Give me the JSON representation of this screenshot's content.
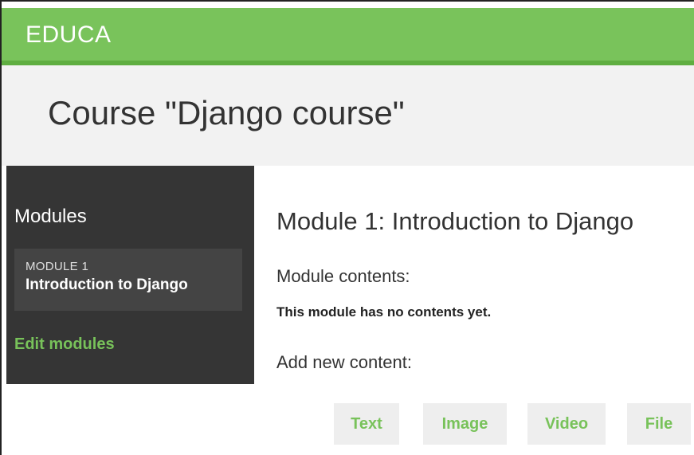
{
  "header": {
    "brand": "EDUCA"
  },
  "course": {
    "title": "Course \"Django course\""
  },
  "sidebar": {
    "title": "Modules",
    "modules": [
      {
        "number": "MODULE 1",
        "name": "Introduction to Django"
      }
    ],
    "edit_link": "Edit modules"
  },
  "main": {
    "module_heading": "Module 1: Introduction to Django",
    "contents_label": "Module contents:",
    "empty_message": "This module has no contents yet.",
    "add_label": "Add new content:",
    "content_buttons": [
      "Text",
      "Image",
      "Video",
      "File"
    ]
  },
  "colors": {
    "brand_green": "#79c35b",
    "brand_green_dark": "#5fae41",
    "sidebar_bg": "#353535",
    "link_green": "#78c25a",
    "title_band_bg": "#f2f2f2"
  }
}
